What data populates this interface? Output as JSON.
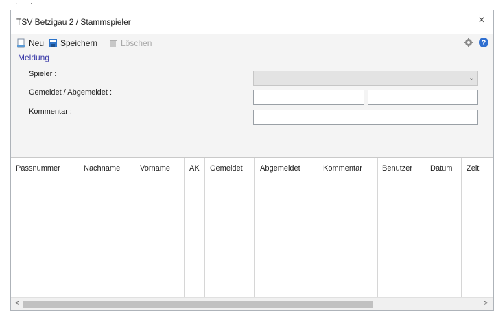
{
  "window": {
    "title": "TSV Betzigau 2 / Stammspieler",
    "close_symbol": "×"
  },
  "toolbar": {
    "new_label": "Neu",
    "save_label": "Speichern",
    "delete_label": "Löschen"
  },
  "form": {
    "section_title": "Meldung",
    "player_label": "Spieler :",
    "reported_label": "Gemeldet / Abgemeldet :",
    "comment_label": "Kommentar :",
    "player_value": "",
    "reported_from_value": "",
    "reported_to_value": "",
    "comment_value": ""
  },
  "grid": {
    "columns": [
      "Passnummer",
      "Nachname",
      "Vorname",
      "AK",
      "Gemeldet",
      "Abgemeldet",
      "Kommentar",
      "Benutzer",
      "Datum",
      "Zeit"
    ],
    "rows": []
  },
  "scrollbar": {
    "left_arrow": "<",
    "right_arrow": ">"
  },
  "colors": {
    "accent": "#3a3aa8",
    "toolbar_bg": "#f4f4f4"
  }
}
